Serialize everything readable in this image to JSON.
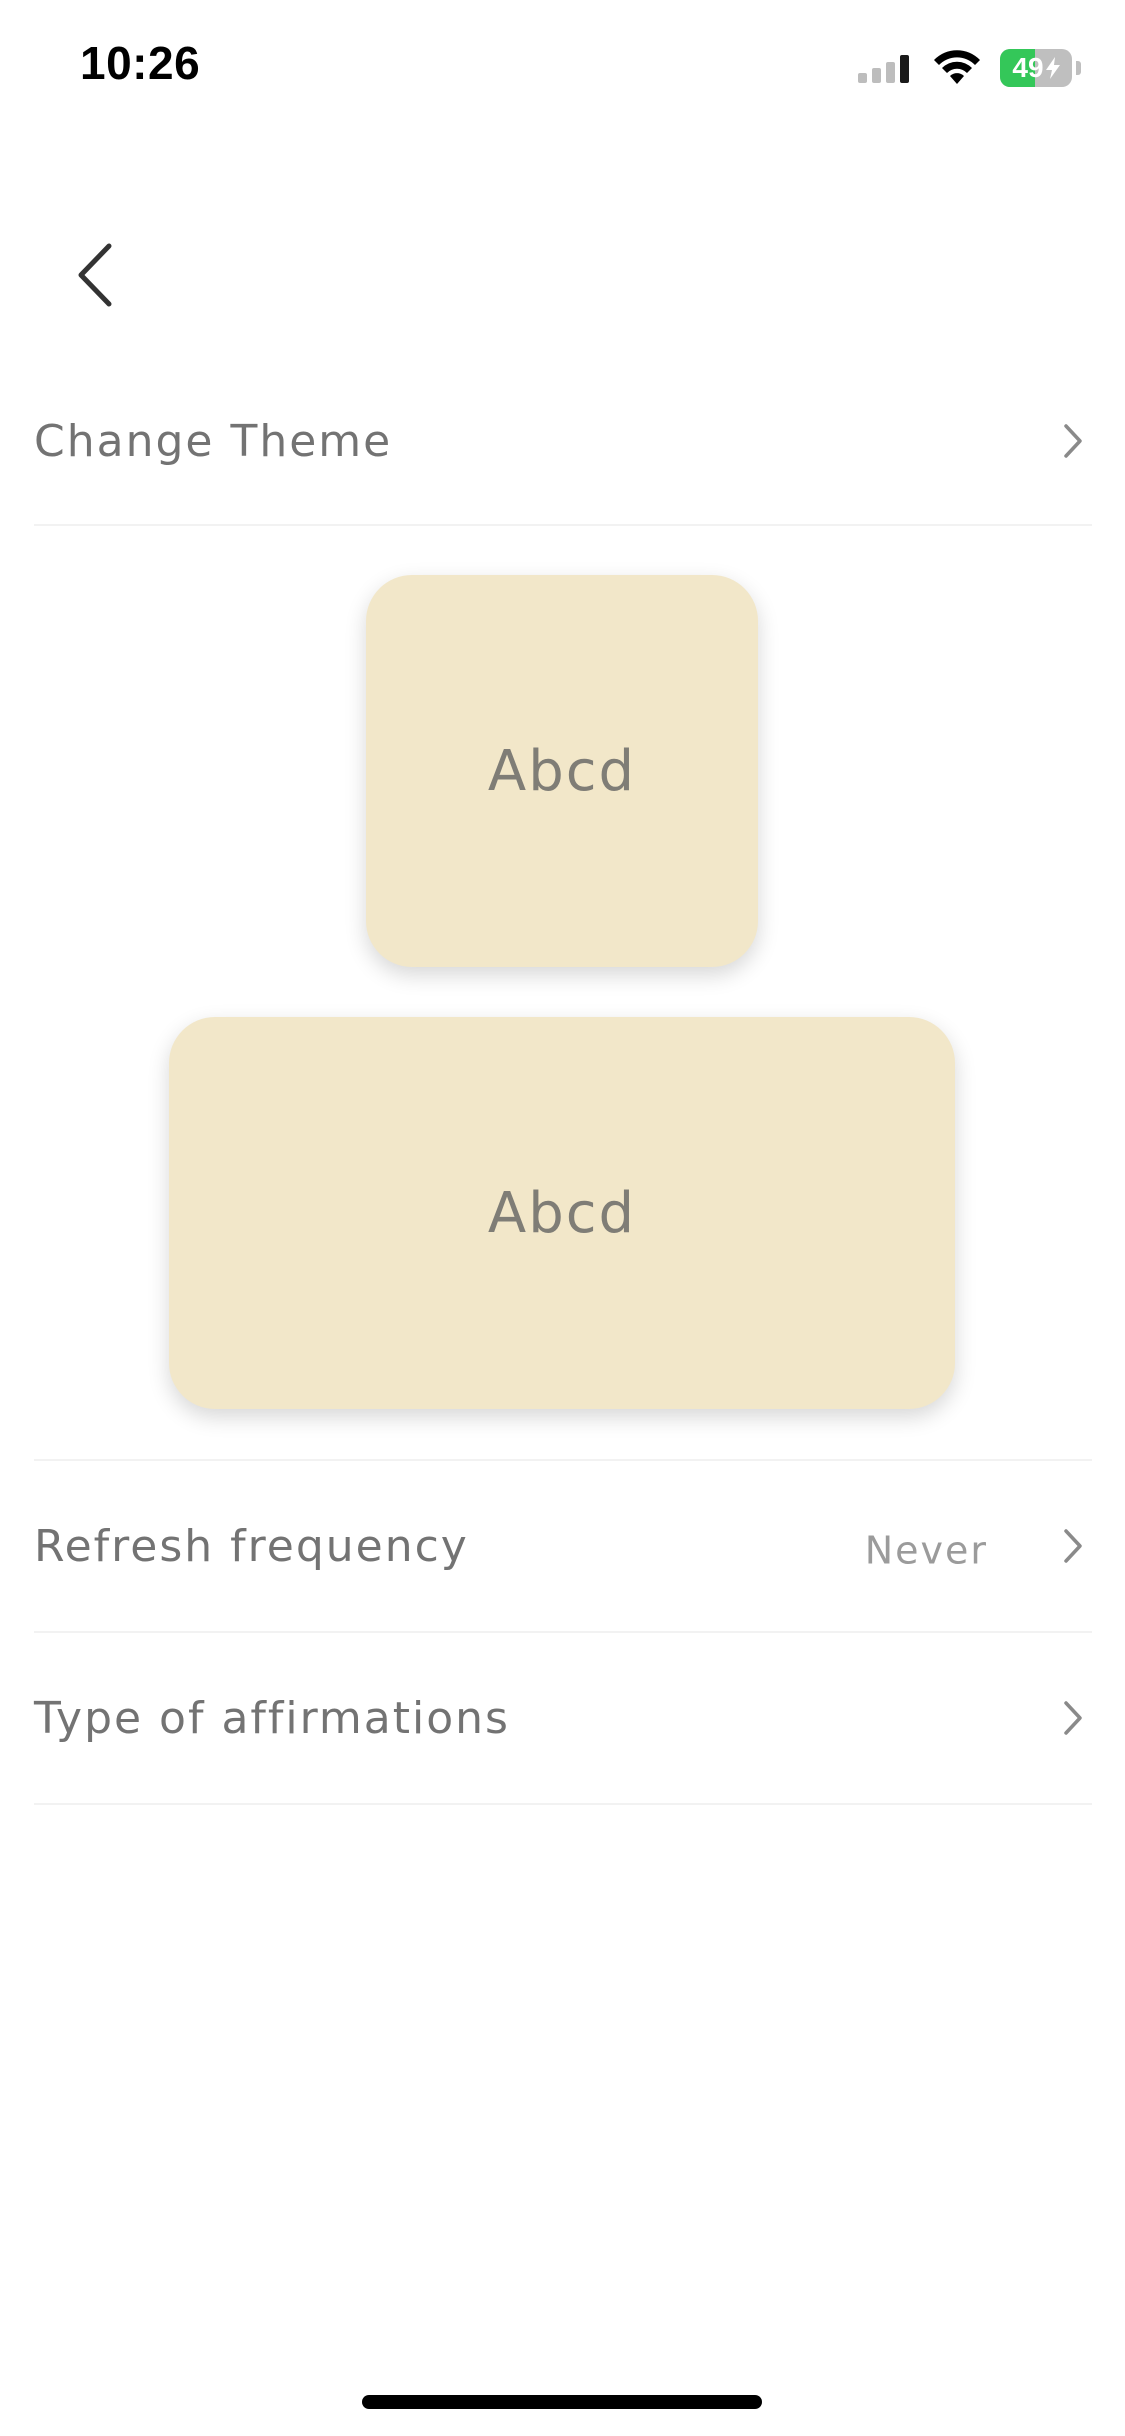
{
  "status_bar": {
    "time": "10:26",
    "battery_level": "49",
    "battery_fraction": 0.49,
    "battery_color": "#34c759",
    "icons": [
      "cellular-signal-icon",
      "wifi-icon",
      "battery-charging-icon"
    ]
  },
  "nav": {
    "back_icon": "chevron-left-icon"
  },
  "settings": {
    "change_theme_label": "Change Theme",
    "refresh_frequency_label": "Refresh frequency",
    "refresh_frequency_value": "Never",
    "type_of_affirmations_label": "Type of affirmations",
    "chevron_icon": "chevron-right-icon"
  },
  "widgets": {
    "small_text": "Abcd",
    "medium_text": "Abcd",
    "background_color": "#f2e7c9"
  }
}
